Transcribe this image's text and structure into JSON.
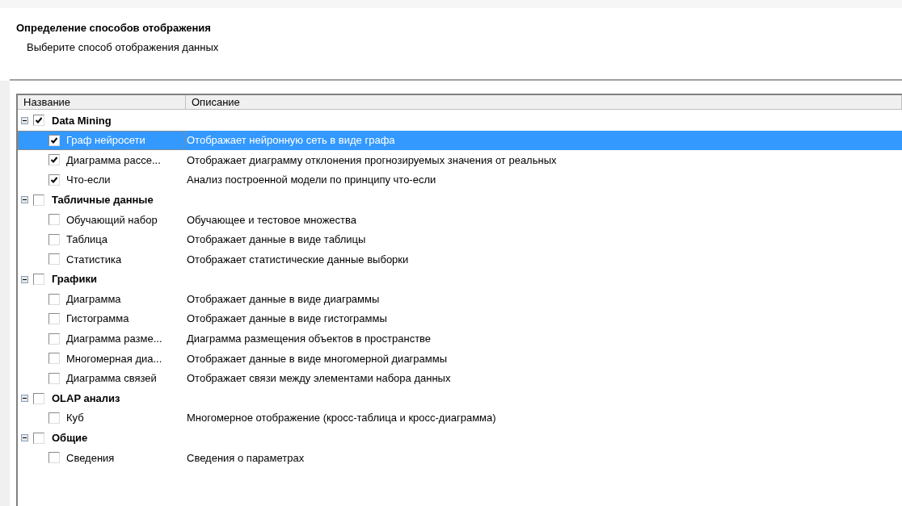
{
  "header": {
    "title": "Определение способов отображения",
    "subtitle": "Выберите способ отображения данных"
  },
  "columns": [
    "Название",
    "Описание"
  ],
  "groups": [
    {
      "name": "Data Mining",
      "checked": true,
      "expanded": true,
      "children": [
        {
          "name": "Граф нейросети",
          "description": "Отображает нейронную сеть в виде графа",
          "checked": true,
          "selected": true
        },
        {
          "name": "Диаграмма рассе...",
          "description": "Отображает диаграмму отклонения прогнозируемых значения от реальных",
          "checked": true,
          "selected": false
        },
        {
          "name": "Что-если",
          "description": "Анализ построенной модели по принципу что-если",
          "checked": true,
          "selected": false
        }
      ]
    },
    {
      "name": "Табличные данные",
      "checked": false,
      "expanded": true,
      "children": [
        {
          "name": "Обучающий набор",
          "description": "Обучающее и тестовое множества",
          "checked": false,
          "selected": false
        },
        {
          "name": "Таблица",
          "description": "Отображает данные в виде таблицы",
          "checked": false,
          "selected": false
        },
        {
          "name": "Статистика",
          "description": "Отображает статистические данные выборки",
          "checked": false,
          "selected": false
        }
      ]
    },
    {
      "name": "Графики",
      "checked": false,
      "expanded": true,
      "children": [
        {
          "name": "Диаграмма",
          "description": "Отображает данные в виде диаграммы",
          "checked": false,
          "selected": false
        },
        {
          "name": "Гистограмма",
          "description": "Отображает данные в виде гистограммы",
          "checked": false,
          "selected": false
        },
        {
          "name": "Диаграмма разме...",
          "description": "Диаграмма размещения объектов в пространстве",
          "checked": false,
          "selected": false
        },
        {
          "name": "Многомерная диа...",
          "description": "Отображает данные в виде многомерной диаграммы",
          "checked": false,
          "selected": false
        },
        {
          "name": "Диаграмма связей",
          "description": "Отображает связи между элементами набора данных",
          "checked": false,
          "selected": false
        }
      ]
    },
    {
      "name": "OLAP анализ",
      "checked": false,
      "expanded": true,
      "children": [
        {
          "name": "Куб",
          "description": "Многомерное отображение (кросс-таблица и кросс-диаграмма)",
          "checked": false,
          "selected": false
        }
      ]
    },
    {
      "name": "Общие",
      "checked": false,
      "expanded": true,
      "children": [
        {
          "name": "Сведения",
          "description": "Сведения о параметрах",
          "checked": false,
          "selected": false
        }
      ]
    }
  ]
}
